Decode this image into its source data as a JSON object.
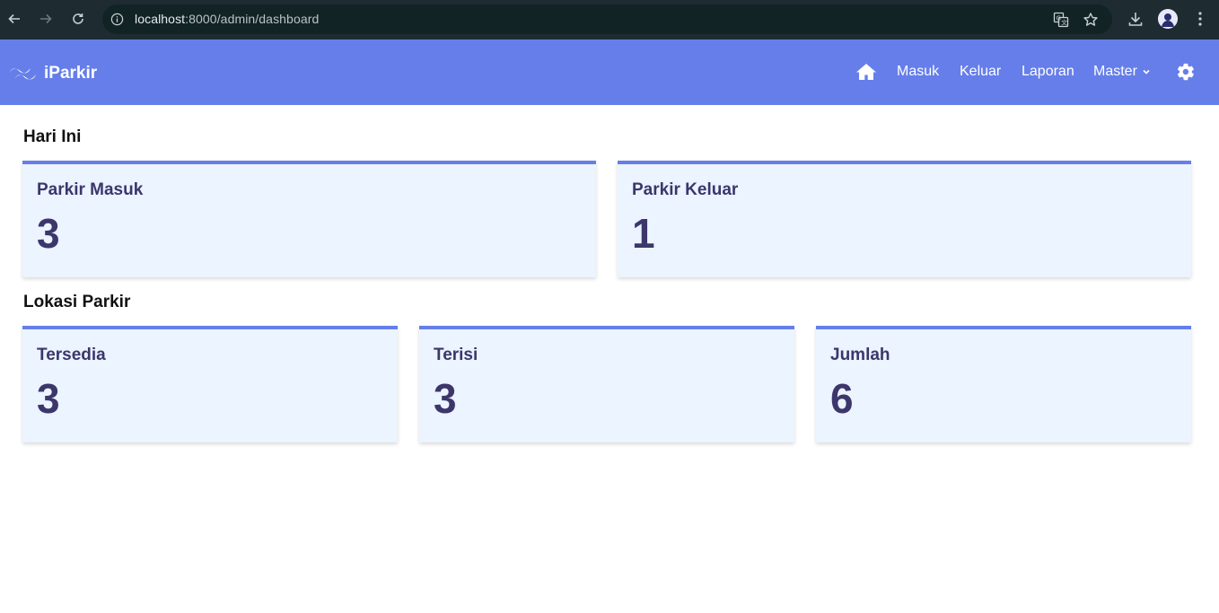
{
  "browser": {
    "url_host": "localhost",
    "url_rest": ":8000/admin/dashboard"
  },
  "navbar": {
    "brand": "iParkir",
    "links": {
      "masuk": "Masuk",
      "keluar": "Keluar",
      "laporan": "Laporan",
      "master": "Master"
    },
    "icons": [
      "home-icon",
      "settings-icon",
      "chevron-down-icon",
      "logo-waves-icon"
    ],
    "color": "#667eea"
  },
  "sections": {
    "today": {
      "title": "Hari Ini",
      "cards": [
        {
          "label": "Parkir Masuk",
          "value": "3"
        },
        {
          "label": "Parkir Keluar",
          "value": "1"
        }
      ]
    },
    "location": {
      "title": "Lokasi Parkir",
      "cards": [
        {
          "label": "Tersedia",
          "value": "3"
        },
        {
          "label": "Terisi",
          "value": "3"
        },
        {
          "label": "Jumlah",
          "value": "6"
        }
      ]
    }
  },
  "colors": {
    "card_bg": "#ebf4ff",
    "card_accent": "#667eea",
    "card_text": "#3c366b"
  }
}
